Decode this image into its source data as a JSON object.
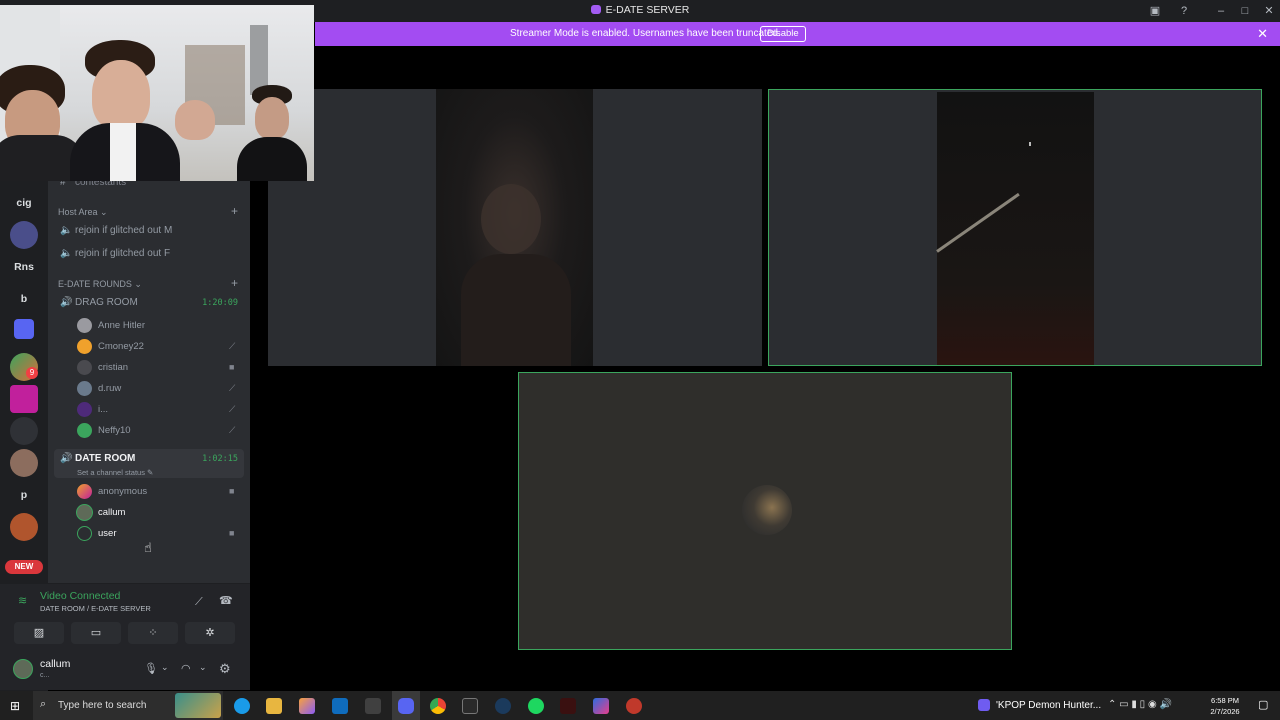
{
  "window": {
    "title": "E-DATE SERVER"
  },
  "banner": {
    "message": "Streamer Mode is enabled. Usernames have been truncated.",
    "action": "Disable"
  },
  "rail": {
    "items": [
      {
        "label": "cig"
      },
      {
        "label": "Rns"
      },
      {
        "label": "b"
      },
      {
        "label": "p"
      }
    ],
    "badge": "9",
    "new_badge": "NEW"
  },
  "sidebar": {
    "partial_channel": "contestants",
    "categories": [
      {
        "name": "Host Area",
        "channels": [
          {
            "name": "rejoin if glitched out M"
          },
          {
            "name": "rejoin if glitched out F"
          }
        ]
      },
      {
        "name": "E-DATE ROUNDS",
        "drag_room": {
          "name": "DRAG ROOM",
          "timer": "1:20:09",
          "members": [
            "Anne Hitler",
            "Cmoney22",
            "cristian",
            "d.ruw",
            "i...",
            "Neffy10"
          ]
        },
        "date_room": {
          "name": "DATE ROOM",
          "timer": "1:02:15",
          "status": "Set a channel status",
          "members": [
            "anonymous",
            "callum",
            "user"
          ]
        }
      }
    ]
  },
  "voice": {
    "status": "Video Connected",
    "location": "DATE ROOM / E-DATE SERVER"
  },
  "user_panel": {
    "name": "callum",
    "status": "c..."
  },
  "taskbar": {
    "search_placeholder": "Type here to search",
    "media": "'KPOP Demon Hunter...",
    "time": "6:58 PM",
    "date": "2/7/2026"
  },
  "colors": {
    "accent": "#a34cf2",
    "speaking": "#3ba55d",
    "sidebar": "#2b2d31"
  }
}
